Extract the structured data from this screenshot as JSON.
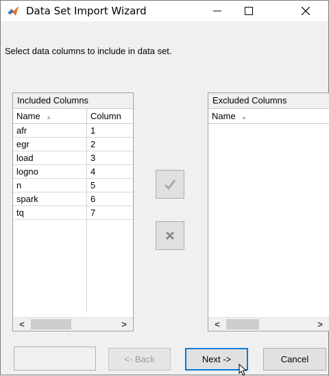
{
  "window": {
    "title": "Data Set Import Wizard",
    "controls": {
      "minimize": "—",
      "maximize": "☐",
      "close": "✕"
    }
  },
  "instruction": "Select data columns to include in data set.",
  "included": {
    "title": "Included Columns",
    "headers": {
      "name": "Name",
      "column": "Column"
    },
    "rows": [
      {
        "name": "afr",
        "column": "1"
      },
      {
        "name": "egr",
        "column": "2"
      },
      {
        "name": "load",
        "column": "3"
      },
      {
        "name": "logno",
        "column": "4"
      },
      {
        "name": "n",
        "column": "5"
      },
      {
        "name": "spark",
        "column": "6"
      },
      {
        "name": "tq",
        "column": "7"
      }
    ]
  },
  "excluded": {
    "title": "Excluded Columns",
    "headers": {
      "name": "Name"
    },
    "rows": []
  },
  "scroll": {
    "left": "<",
    "right": ">"
  },
  "buttons": {
    "back": "<- Back",
    "next": "Next ->",
    "cancel": "Cancel"
  },
  "icons": {
    "app": "matlab-logo-icon",
    "include": "checkmark-icon",
    "exclude": "x-icon",
    "sort": "sort-ascending-icon"
  },
  "colors": {
    "focus": "#0078d7",
    "disabled_text": "#9a9a9a"
  }
}
